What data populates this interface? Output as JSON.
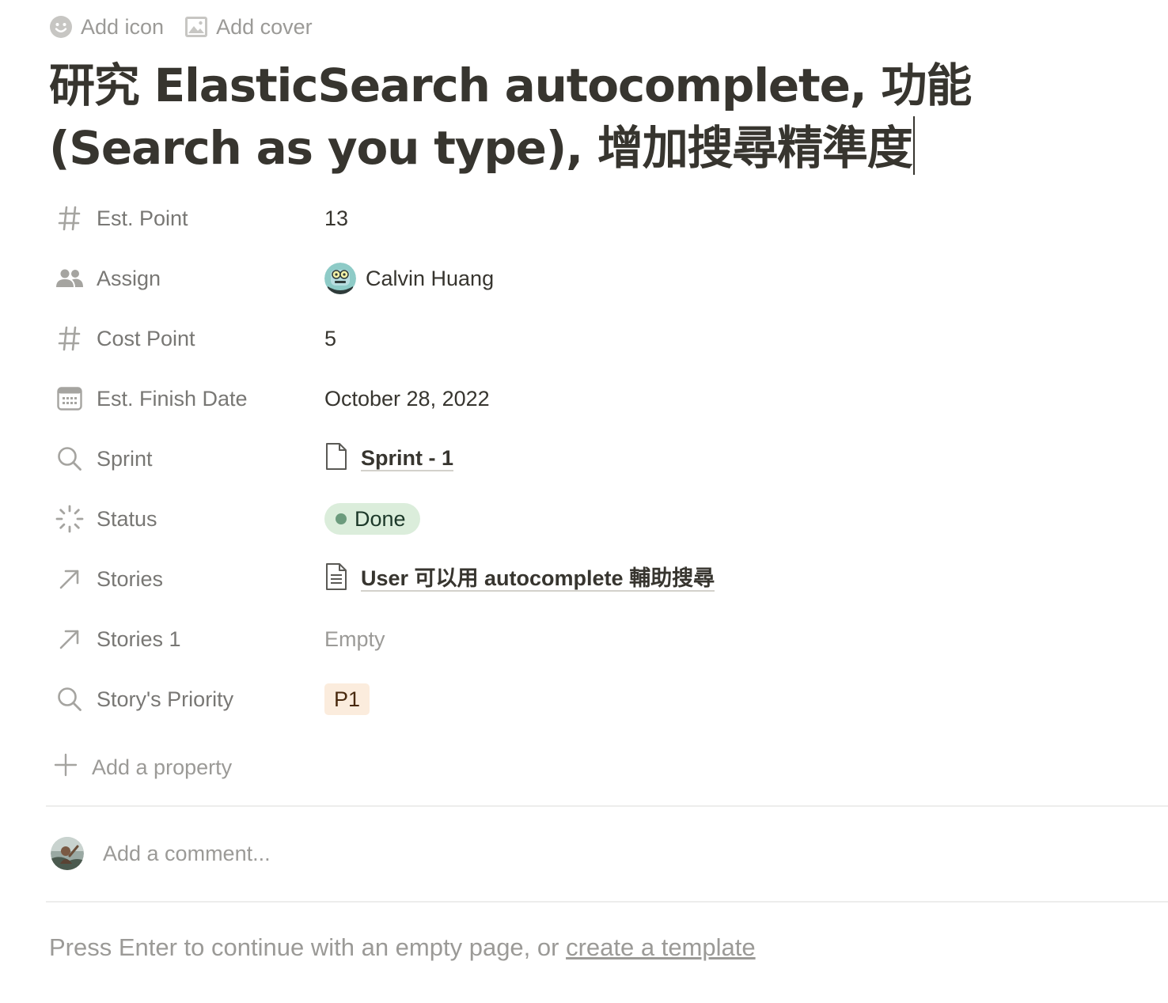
{
  "top_actions": {
    "add_icon": "Add icon",
    "add_cover": "Add cover"
  },
  "title": "研究 ElasticSearch autocomplete, 功能 (Search as you type), 增加搜尋精準度",
  "properties": [
    {
      "name": "Est. Point",
      "icon": "hash-icon",
      "value": "13"
    },
    {
      "name": "Assign",
      "icon": "people-icon",
      "value": "Calvin Huang"
    },
    {
      "name": "Cost Point",
      "icon": "hash-icon",
      "value": "5"
    },
    {
      "name": "Est. Finish Date",
      "icon": "calendar-icon",
      "value": "October 28, 2022"
    },
    {
      "name": "Sprint",
      "icon": "search-icon",
      "value": "Sprint - 1"
    },
    {
      "name": "Status",
      "icon": "status-spinner-icon",
      "value": "Done",
      "color": "#dbeddb"
    },
    {
      "name": "Stories",
      "icon": "arrow-up-right-icon",
      "value": "User 可以用 autocomplete 輔助搜尋"
    },
    {
      "name": "Stories 1",
      "icon": "arrow-up-right-icon",
      "value": "Empty"
    },
    {
      "name": "Story's Priority",
      "icon": "search-icon",
      "value": "P1",
      "color": "#fbecdd"
    }
  ],
  "add_property": "Add a property",
  "comment": {
    "placeholder": "Add a comment..."
  },
  "footer": {
    "text": "Press Enter to continue with an empty page, or ",
    "link": "create a template"
  }
}
